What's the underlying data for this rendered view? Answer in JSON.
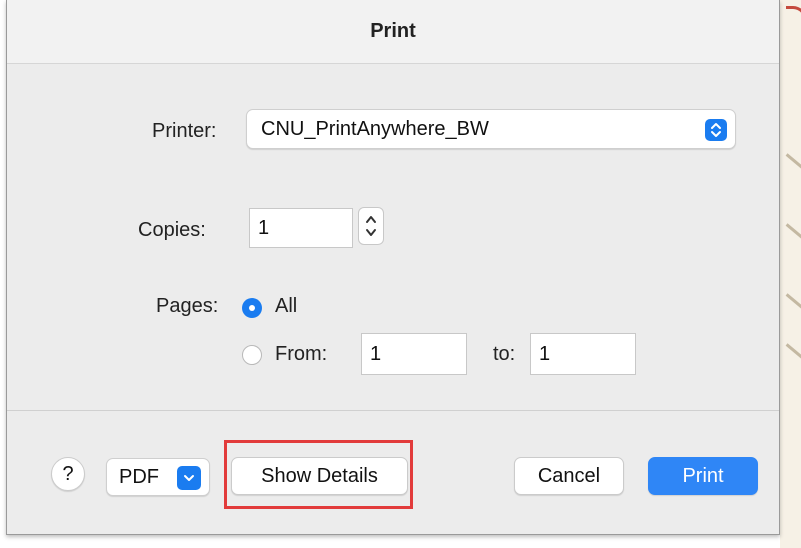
{
  "window": {
    "title": "Print"
  },
  "printer": {
    "label": "Printer:",
    "value": "CNU_PrintAnywhere_BW",
    "chevron_icon": "up-down-chevron-icon"
  },
  "copies": {
    "label": "Copies:",
    "value": "1",
    "stepper_icon": "stepper-icon"
  },
  "pages": {
    "label": "Pages:",
    "all_label": "All",
    "from_label": "From:",
    "from_value": "1",
    "to_label": "to:",
    "to_value": "1",
    "selected": "All"
  },
  "footer": {
    "help_label": "?",
    "pdf_label": "PDF",
    "pdf_chevron_icon": "chevron-down-icon",
    "show_details_label": "Show Details",
    "cancel_label": "Cancel",
    "print_label": "Print"
  },
  "colors": {
    "accent": "#2f86f6",
    "highlight": "#e23b3b"
  }
}
